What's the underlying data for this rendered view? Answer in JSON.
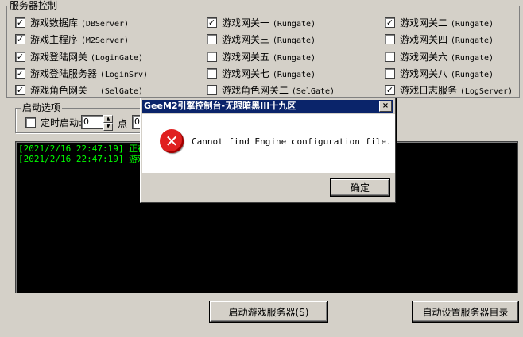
{
  "server_control": {
    "title": "服务器控制",
    "items": [
      {
        "label": "游戏数据库",
        "code": "(DBServer)",
        "checked": true
      },
      {
        "label": "游戏网关一",
        "code": "(Rungate)",
        "checked": true
      },
      {
        "label": "游戏网关二",
        "code": "(Rungate)",
        "checked": true
      },
      {
        "label": "游戏主程序",
        "code": "(M2Server)",
        "checked": true
      },
      {
        "label": "游戏网关三",
        "code": "(Rungate)",
        "checked": false
      },
      {
        "label": "游戏网关四",
        "code": "(Rungate)",
        "checked": false
      },
      {
        "label": "游戏登陆网关",
        "code": "(LoginGate)",
        "checked": true
      },
      {
        "label": "游戏网关五",
        "code": "(Rungate)",
        "checked": false
      },
      {
        "label": "游戏网关六",
        "code": "(Rungate)",
        "checked": false
      },
      {
        "label": "游戏登陆服务器",
        "code": "(LoginSrv)",
        "checked": true
      },
      {
        "label": "游戏网关七",
        "code": "(Rungate)",
        "checked": false
      },
      {
        "label": "游戏网关八",
        "code": "(Rungate)",
        "checked": false
      },
      {
        "label": "游戏角色网关一",
        "code": "(SelGate)",
        "checked": true
      },
      {
        "label": "游戏角色网关二",
        "code": "(SelGate)",
        "checked": false
      },
      {
        "label": "游戏日志服务",
        "code": "(LogServer)",
        "checked": true
      }
    ]
  },
  "startup": {
    "title": "启动选项",
    "timed_label": "定时启动:",
    "timed_checked": false,
    "hour_value": "0",
    "point_label": "点",
    "minute_value": "0"
  },
  "log_lines": [
    "[2021/2/16 22:47:19] 正在",
    "[2021/2/16 22:47:19] 游戏"
  ],
  "buttons": {
    "start": "启动游戏服务器(S)",
    "auto_dir": "自动设置服务器目录"
  },
  "dialog": {
    "title": "GeeM2引擎控制台-无限暗黑III十九区",
    "message": "Cannot find Engine configuration file.",
    "ok": "确定",
    "close": "×"
  },
  "colors": {
    "face": "#d4d0c8",
    "titlebar": "#0a246a",
    "log_text": "#00ff00",
    "error_red": "#e02020"
  }
}
